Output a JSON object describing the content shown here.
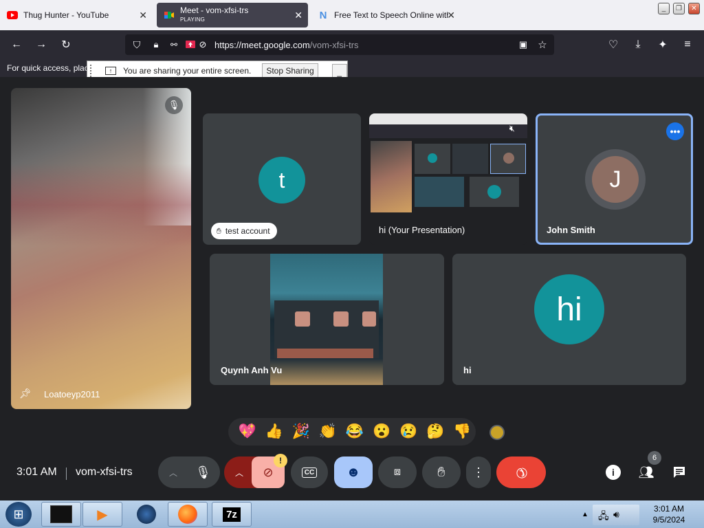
{
  "browser": {
    "tabs": [
      {
        "title": "Thug Hunter - YouTube",
        "subtitle": ""
      },
      {
        "title": "Meet - vom-xfsi-trs",
        "subtitle": "PLAYING"
      },
      {
        "title": "Free Text to Speech Online with",
        "subtitle": ""
      }
    ],
    "url_host": "https://meet.google.com",
    "url_path": "/vom-xfsi-trs",
    "bookmark_hint": "For quick access, plac"
  },
  "share_banner": {
    "message": "You are sharing your entire screen.",
    "stop_label": "Stop Sharing",
    "min_label": "_"
  },
  "tiles": {
    "pinned": {
      "name": "Loatoeyp2011"
    },
    "test_account": {
      "initial": "t",
      "name": "test account"
    },
    "presentation": {
      "name": "hi (Your Presentation)"
    },
    "john": {
      "initial": "J",
      "name": "John Smith"
    },
    "quynh": {
      "name": "Quynh Anh Vu"
    },
    "hi": {
      "initial": "hi",
      "name": "hi"
    }
  },
  "reactions": [
    "💖",
    "👍",
    "🎉",
    "👏",
    "😂",
    "😮",
    "😢",
    "🤔",
    "👎"
  ],
  "controls": {
    "time": "3:01 AM",
    "meeting_code": "vom-xfsi-trs",
    "people_count": "6",
    "camera_warning": "!"
  },
  "taskbar": {
    "time": "3:01 AM",
    "date": "9/5/2024",
    "app_7z": "7z"
  },
  "colors": {
    "teal_avatar": "#12939a",
    "john_avatar": "#8d6e63",
    "end_call": "#ea4335",
    "reactions_active": "#8ab4f8",
    "pinned_border": "#8ab4f8"
  }
}
